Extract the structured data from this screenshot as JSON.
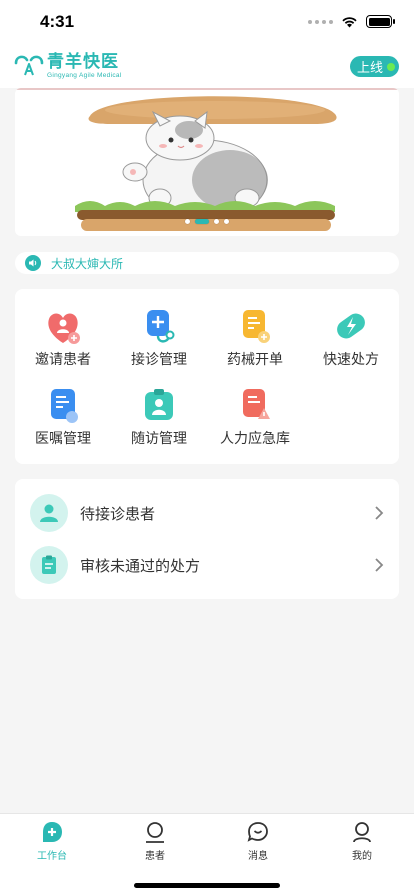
{
  "status_bar": {
    "time": "4:31"
  },
  "header": {
    "logo_cn": "青羊快医",
    "logo_en": "Gingyang Agile Medical",
    "online_label": "上线"
  },
  "notice": {
    "text": "大叔大婶大所"
  },
  "features": [
    {
      "label": "邀请患者",
      "icon": "invite-patient-icon"
    },
    {
      "label": "接诊管理",
      "icon": "stethoscope-icon"
    },
    {
      "label": "药械开单",
      "icon": "prescription-order-icon"
    },
    {
      "label": "快速处方",
      "icon": "pill-icon"
    },
    {
      "label": "医嘱管理",
      "icon": "medical-order-icon"
    },
    {
      "label": "随访管理",
      "icon": "follow-up-icon"
    },
    {
      "label": "人力应急库",
      "icon": "emergency-icon"
    }
  ],
  "list": [
    {
      "label": "待接诊患者"
    },
    {
      "label": "审核未通过的处方"
    }
  ],
  "tabs": [
    {
      "label": "工作台",
      "active": true
    },
    {
      "label": "患者"
    },
    {
      "label": "消息"
    },
    {
      "label": "我的"
    }
  ],
  "colors": {
    "accent": "#2ab8b3",
    "online_dot": "#6bea52",
    "background": "#f5f5f5"
  }
}
